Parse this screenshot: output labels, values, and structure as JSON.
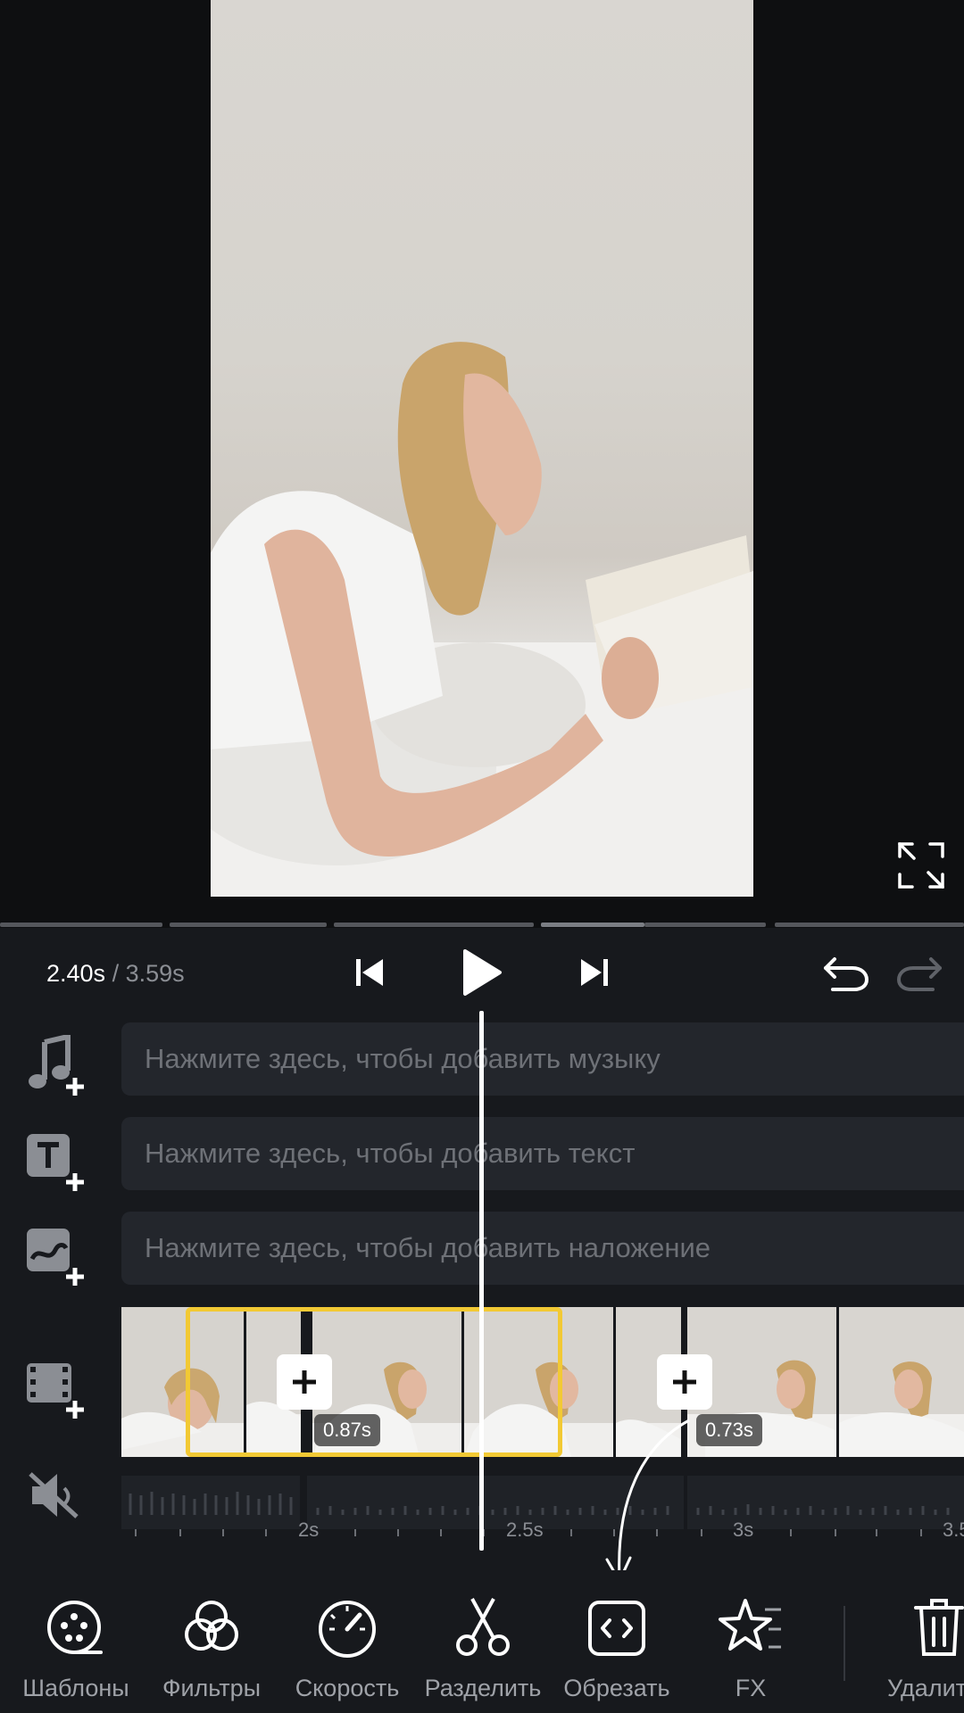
{
  "player": {
    "current_time": "2.40s",
    "separator": "/",
    "total_time": "3.59s"
  },
  "tracks": {
    "music_placeholder": "Нажмите здесь, чтобы добавить музыку",
    "text_placeholder": "Нажмите здесь, чтобы добавить текст",
    "overlay_placeholder": "Нажмите здесь, чтобы добавить наложение"
  },
  "clips": {
    "selected_duration": "0.87s",
    "next_duration": "0.73s"
  },
  "ruler": {
    "labels": [
      "2s",
      "2.5s",
      "3s",
      "3.5"
    ]
  },
  "toolbar": {
    "items": [
      {
        "label": "Шаблоны",
        "icon": "templates-icon"
      },
      {
        "label": "Фильтры",
        "icon": "filters-icon"
      },
      {
        "label": "Скорость",
        "icon": "speed-icon"
      },
      {
        "label": "Разделить",
        "icon": "scissors-icon"
      },
      {
        "label": "Обрезать",
        "icon": "trim-icon"
      },
      {
        "label": "FX",
        "icon": "fx-star-icon"
      },
      {
        "label": "Удалит",
        "icon": "trash-icon"
      }
    ]
  },
  "colors": {
    "accent_selection": "#f2c934",
    "panel_bg": "#17191d",
    "track_bg": "#23262c"
  }
}
